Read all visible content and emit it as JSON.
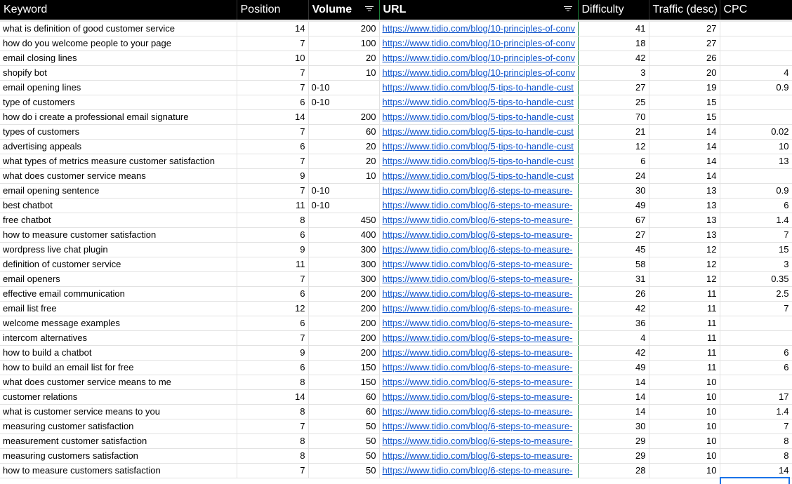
{
  "headers": {
    "keyword": "Keyword",
    "position": "Position",
    "volume": "Volume",
    "url": "URL",
    "difficulty": "Difficulty",
    "traffic": "Traffic (desc)",
    "cpc": "CPC"
  },
  "icons": {
    "filter": "filter-icon"
  },
  "colors": {
    "header_bg": "#000000",
    "link": "#1155cc",
    "selection_border": "#188038",
    "active_cell": "#1a73e8"
  },
  "rows": [
    {
      "keyword": "what is definition of good customer service",
      "position": "14",
      "volume": "200",
      "url": "https://www.tidio.com/blog/10-principles-of-conv",
      "difficulty": "41",
      "traffic": "27",
      "cpc": ""
    },
    {
      "keyword": "how do you welcome people to your page",
      "position": "7",
      "volume": "100",
      "url": "https://www.tidio.com/blog/10-principles-of-conv",
      "difficulty": "18",
      "traffic": "27",
      "cpc": ""
    },
    {
      "keyword": "email closing lines",
      "position": "10",
      "volume": "20",
      "url": "https://www.tidio.com/blog/10-principles-of-conv",
      "difficulty": "42",
      "traffic": "26",
      "cpc": ""
    },
    {
      "keyword": "shopify bot",
      "position": "7",
      "volume": "10",
      "url": "https://www.tidio.com/blog/10-principles-of-conv",
      "difficulty": "3",
      "traffic": "20",
      "cpc": "4"
    },
    {
      "keyword": "email opening lines",
      "position": "7",
      "volume": "0-10",
      "url": "https://www.tidio.com/blog/5-tips-to-handle-cust",
      "difficulty": "27",
      "traffic": "19",
      "cpc": "0.9"
    },
    {
      "keyword": "type of customers",
      "position": "6",
      "volume": "0-10",
      "url": "https://www.tidio.com/blog/5-tips-to-handle-cust",
      "difficulty": "25",
      "traffic": "15",
      "cpc": ""
    },
    {
      "keyword": "how do i create a professional email signature",
      "position": "14",
      "volume": "200",
      "url": "https://www.tidio.com/blog/5-tips-to-handle-cust",
      "difficulty": "70",
      "traffic": "15",
      "cpc": ""
    },
    {
      "keyword": "types of customers",
      "position": "7",
      "volume": "60",
      "url": "https://www.tidio.com/blog/5-tips-to-handle-cust",
      "difficulty": "21",
      "traffic": "14",
      "cpc": "0.02"
    },
    {
      "keyword": "advertising appeals",
      "position": "6",
      "volume": "20",
      "url": "https://www.tidio.com/blog/5-tips-to-handle-cust",
      "difficulty": "12",
      "traffic": "14",
      "cpc": "10"
    },
    {
      "keyword": "what types of metrics measure customer satisfaction",
      "position": "7",
      "volume": "20",
      "url": "https://www.tidio.com/blog/5-tips-to-handle-cust",
      "difficulty": "6",
      "traffic": "14",
      "cpc": "13"
    },
    {
      "keyword": "what does customer service means",
      "position": "9",
      "volume": "10",
      "url": "https://www.tidio.com/blog/5-tips-to-handle-cust",
      "difficulty": "24",
      "traffic": "14",
      "cpc": ""
    },
    {
      "keyword": "email opening sentence",
      "position": "7",
      "volume": "0-10",
      "url": "https://www.tidio.com/blog/6-steps-to-measure-",
      "difficulty": "30",
      "traffic": "13",
      "cpc": "0.9"
    },
    {
      "keyword": "best chatbot",
      "position": "11",
      "volume": "0-10",
      "url": "https://www.tidio.com/blog/6-steps-to-measure-",
      "difficulty": "49",
      "traffic": "13",
      "cpc": "6"
    },
    {
      "keyword": "free chatbot",
      "position": "8",
      "volume": "450",
      "url": "https://www.tidio.com/blog/6-steps-to-measure-",
      "difficulty": "67",
      "traffic": "13",
      "cpc": "1.4"
    },
    {
      "keyword": "how to measure customer satisfaction",
      "position": "6",
      "volume": "400",
      "url": "https://www.tidio.com/blog/6-steps-to-measure-",
      "difficulty": "27",
      "traffic": "13",
      "cpc": "7"
    },
    {
      "keyword": "wordpress live chat plugin",
      "position": "9",
      "volume": "300",
      "url": "https://www.tidio.com/blog/6-steps-to-measure-",
      "difficulty": "45",
      "traffic": "12",
      "cpc": "15"
    },
    {
      "keyword": "definition of customer service",
      "position": "11",
      "volume": "300",
      "url": "https://www.tidio.com/blog/6-steps-to-measure-",
      "difficulty": "58",
      "traffic": "12",
      "cpc": "3"
    },
    {
      "keyword": "email openers",
      "position": "7",
      "volume": "300",
      "url": "https://www.tidio.com/blog/6-steps-to-measure-",
      "difficulty": "31",
      "traffic": "12",
      "cpc": "0.35"
    },
    {
      "keyword": "effective email communication",
      "position": "6",
      "volume": "200",
      "url": "https://www.tidio.com/blog/6-steps-to-measure-",
      "difficulty": "26",
      "traffic": "11",
      "cpc": "2.5"
    },
    {
      "keyword": "email list free",
      "position": "12",
      "volume": "200",
      "url": "https://www.tidio.com/blog/6-steps-to-measure-",
      "difficulty": "42",
      "traffic": "11",
      "cpc": "7"
    },
    {
      "keyword": "welcome message examples",
      "position": "6",
      "volume": "200",
      "url": "https://www.tidio.com/blog/6-steps-to-measure-",
      "difficulty": "36",
      "traffic": "11",
      "cpc": ""
    },
    {
      "keyword": "intercom alternatives",
      "position": "7",
      "volume": "200",
      "url": "https://www.tidio.com/blog/6-steps-to-measure-",
      "difficulty": "4",
      "traffic": "11",
      "cpc": ""
    },
    {
      "keyword": "how to build a chatbot",
      "position": "9",
      "volume": "200",
      "url": "https://www.tidio.com/blog/6-steps-to-measure-",
      "difficulty": "42",
      "traffic": "11",
      "cpc": "6"
    },
    {
      "keyword": "how to build an email list for free",
      "position": "6",
      "volume": "150",
      "url": "https://www.tidio.com/blog/6-steps-to-measure-",
      "difficulty": "49",
      "traffic": "11",
      "cpc": "6"
    },
    {
      "keyword": "what does customer service means to me",
      "position": "8",
      "volume": "150",
      "url": "https://www.tidio.com/blog/6-steps-to-measure-",
      "difficulty": "14",
      "traffic": "10",
      "cpc": ""
    },
    {
      "keyword": "customer relations",
      "position": "14",
      "volume": "60",
      "url": "https://www.tidio.com/blog/6-steps-to-measure-",
      "difficulty": "14",
      "traffic": "10",
      "cpc": "17"
    },
    {
      "keyword": "what is customer service means to you",
      "position": "8",
      "volume": "60",
      "url": "https://www.tidio.com/blog/6-steps-to-measure-",
      "difficulty": "14",
      "traffic": "10",
      "cpc": "1.4"
    },
    {
      "keyword": "measuring customer satisfaction",
      "position": "7",
      "volume": "50",
      "url": "https://www.tidio.com/blog/6-steps-to-measure-",
      "difficulty": "30",
      "traffic": "10",
      "cpc": "7"
    },
    {
      "keyword": "measurement customer satisfaction",
      "position": "8",
      "volume": "50",
      "url": "https://www.tidio.com/blog/6-steps-to-measure-",
      "difficulty": "29",
      "traffic": "10",
      "cpc": "8"
    },
    {
      "keyword": "measuring customers satisfaction",
      "position": "8",
      "volume": "50",
      "url": "https://www.tidio.com/blog/6-steps-to-measure-",
      "difficulty": "29",
      "traffic": "10",
      "cpc": "8"
    },
    {
      "keyword": "how to measure customers satisfaction",
      "position": "7",
      "volume": "50",
      "url": "https://www.tidio.com/blog/6-steps-to-measure-",
      "difficulty": "28",
      "traffic": "10",
      "cpc": "14"
    }
  ]
}
